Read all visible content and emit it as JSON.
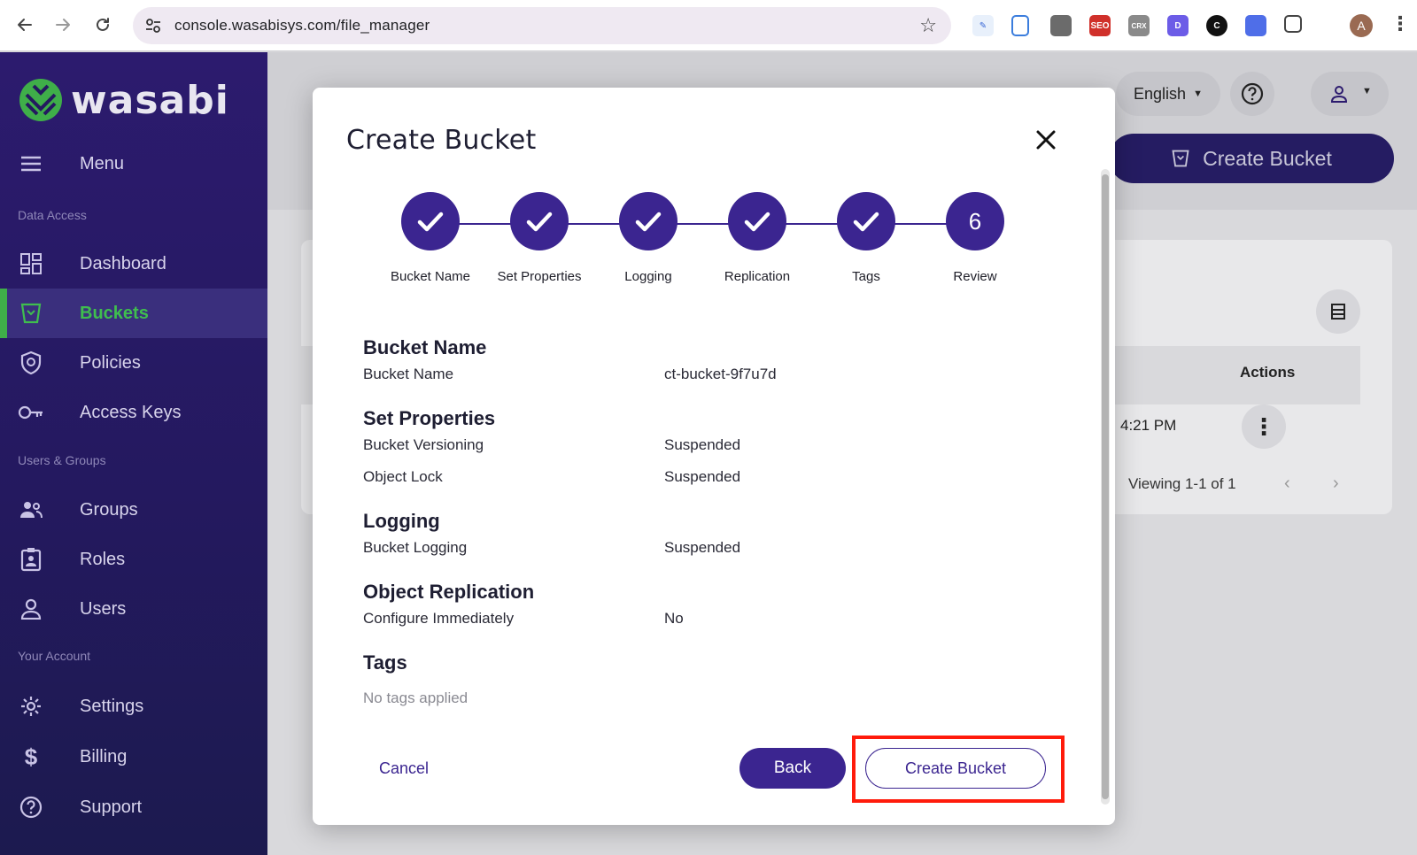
{
  "browser": {
    "url": "console.wasabisys.com/file_manager",
    "avatar_letter": "A",
    "ext_labels": {
      "seo": "SEO",
      "crx": "CRX",
      "d": "D",
      "c": "C"
    }
  },
  "sidebar": {
    "brand": "wasabi",
    "menu_label": "Menu",
    "sections": {
      "data_access": "Data Access",
      "users_groups": "Users & Groups",
      "your_account": "Your Account"
    },
    "items": [
      {
        "label": "Dashboard",
        "icon": "dashboard-icon"
      },
      {
        "label": "Buckets",
        "icon": "bucket-icon",
        "active": true
      },
      {
        "label": "Policies",
        "icon": "shield-icon"
      },
      {
        "label": "Access Keys",
        "icon": "key-icon"
      },
      {
        "label": "Groups",
        "icon": "groups-icon"
      },
      {
        "label": "Roles",
        "icon": "badge-icon"
      },
      {
        "label": "Users",
        "icon": "user-icon"
      },
      {
        "label": "Settings",
        "icon": "gear-icon"
      },
      {
        "label": "Billing",
        "icon": "dollar-icon"
      },
      {
        "label": "Support",
        "icon": "help-icon"
      }
    ],
    "active_color": "#3fbe4e",
    "bg_color": "#2c1b6e"
  },
  "header": {
    "language": "English",
    "create_bucket": "Create Bucket"
  },
  "table": {
    "actions_header": "Actions",
    "row_time": "4:21 PM",
    "viewing": "Viewing 1-1 of 1"
  },
  "modal": {
    "title": "Create Bucket",
    "steps": [
      {
        "label": "Bucket Name",
        "state": "done"
      },
      {
        "label": "Set Properties",
        "state": "done"
      },
      {
        "label": "Logging",
        "state": "done"
      },
      {
        "label": "Replication",
        "state": "done"
      },
      {
        "label": "Tags",
        "state": "done"
      },
      {
        "label": "Review",
        "state": "current",
        "number": "6"
      }
    ],
    "review": {
      "bucket_name_h": "Bucket Name",
      "bucket_name_k": "Bucket Name",
      "bucket_name_v": "ct-bucket-9f7u7d",
      "set_props_h": "Set Properties",
      "versioning_k": "Bucket Versioning",
      "versioning_v": "Suspended",
      "object_lock_k": "Object Lock",
      "object_lock_v": "Suspended",
      "logging_h": "Logging",
      "logging_k": "Bucket Logging",
      "logging_v": "Suspended",
      "replication_h": "Object Replication",
      "replication_k": "Configure Immediately",
      "replication_v": "No",
      "tags_h": "Tags",
      "tags_none": "No tags applied"
    },
    "cancel": "Cancel",
    "back": "Back",
    "create": "Create Bucket",
    "accent": "#3b2590",
    "highlight_color": "#ff1b0b"
  }
}
